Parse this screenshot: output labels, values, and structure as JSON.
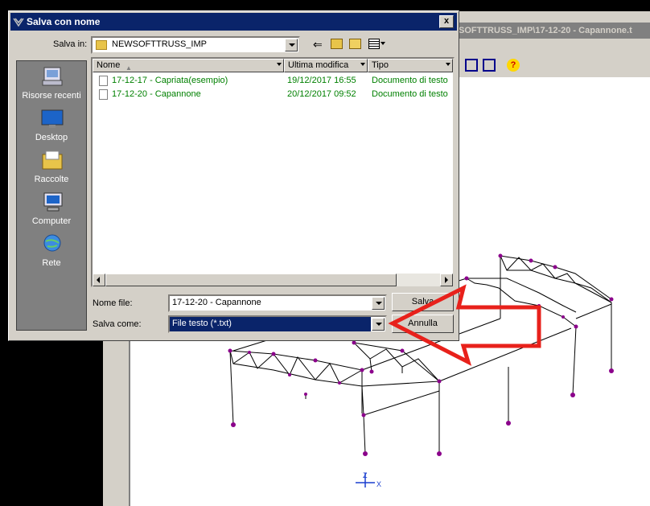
{
  "background_app": {
    "title": "SOFTTRUSS_IMP\\17-12-20 - Capannone.t",
    "axis_labels": {
      "z": "Z",
      "x": "X"
    }
  },
  "dialog": {
    "title": "Salva con nome",
    "close_label": "x",
    "save_in_label": "Salva in:",
    "save_in_value": "NEWSOFTTRUSS_IMP",
    "places": [
      {
        "label": "Risorse recenti",
        "icon": "recent-places-icon"
      },
      {
        "label": "Desktop",
        "icon": "desktop-icon"
      },
      {
        "label": "Raccolte",
        "icon": "libraries-icon"
      },
      {
        "label": "Computer",
        "icon": "computer-icon"
      },
      {
        "label": "Rete",
        "icon": "network-icon"
      }
    ],
    "columns": [
      "Nome",
      "Ultima modifica",
      "Tipo"
    ],
    "files": [
      {
        "name": "17-12-17 - Capriata(esempio)",
        "modified": "19/12/2017 16:55",
        "type": "Documento di testo"
      },
      {
        "name": "17-12-20 - Capannone",
        "modified": "20/12/2017 09:52",
        "type": "Documento di testo"
      }
    ],
    "filename_label": "Nome file:",
    "filename_value": "17-12-20 - Capannone",
    "savetype_label": "Salva come:",
    "savetype_value": "File testo (*.txt)",
    "save_button": "Salva",
    "cancel_button": "Annulla"
  },
  "colors": {
    "title_bar": "#0a246a",
    "file_text": "#008000",
    "annotation_arrow": "#e8211b",
    "node": "#8b008b"
  }
}
